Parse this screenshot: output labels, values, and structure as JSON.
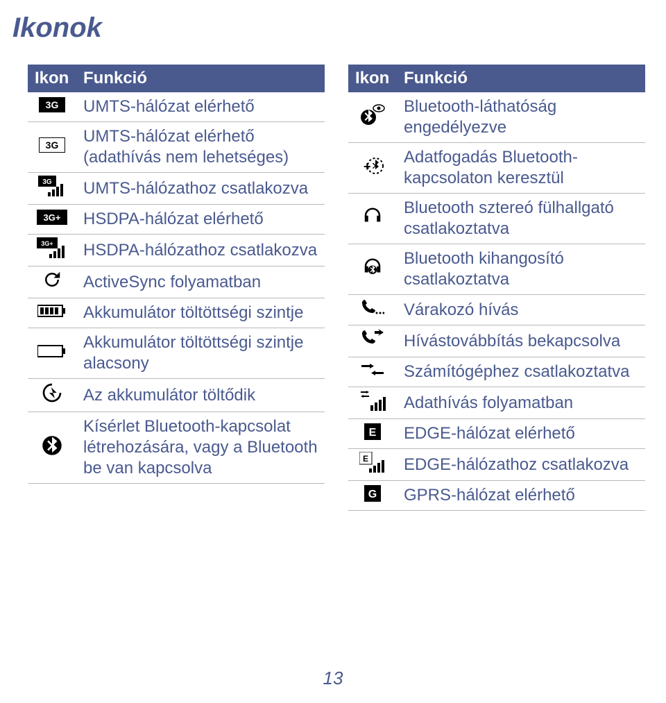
{
  "title": "Ikonok",
  "pageNumber": "13",
  "headers": {
    "icon": "Ikon",
    "func": "Funkció"
  },
  "left": [
    {
      "icon": "3g-box",
      "label": "UMTS-hálózat elérhető"
    },
    {
      "icon": "3g-outline",
      "label": "UMTS-hálózat elérhető (adathívás nem lehetséges)"
    },
    {
      "icon": "3g-signal",
      "label": "UMTS-hálózathoz csatlakozva"
    },
    {
      "icon": "3gplus-box",
      "label": "HSDPA-hálózat elérhető"
    },
    {
      "icon": "3gplus-signal",
      "label": "HSDPA-hálózathoz csatlakozva"
    },
    {
      "icon": "sync-arrows",
      "label": "ActiveSync folyamatban"
    },
    {
      "icon": "battery-full",
      "label": "Akkumulátor töltöttségi szintje"
    },
    {
      "icon": "battery-low",
      "label": "Akkumulátor töltöttségi szintje alacsony"
    },
    {
      "icon": "battery-charge",
      "label": "Az akkumulátor töltődik"
    },
    {
      "icon": "bluetooth",
      "label": "Kísérlet Bluetooth-kapcsolat létrehozására, vagy a Bluetooth be van kapcsolva"
    }
  ],
  "right": [
    {
      "icon": "bluetooth-eye",
      "label": "Bluetooth-láthatóság engedélyezve"
    },
    {
      "icon": "bluetooth-recv",
      "label": "Adatfogadás Bluetooth-kapcsolaton keresztül"
    },
    {
      "icon": "headphones",
      "label": "Bluetooth sztereó fülhallgató csatlakoztatva"
    },
    {
      "icon": "headphones-bt",
      "label": "Bluetooth kihangosító csatlakoztatva"
    },
    {
      "icon": "call-waiting",
      "label": "Várakozó hívás"
    },
    {
      "icon": "call-forward",
      "label": "Hívástovábbítás bekapcsolva"
    },
    {
      "icon": "pc-connect",
      "label": "Számítógéphez csatlakoztatva"
    },
    {
      "icon": "data-signal",
      "label": "Adathívás folyamatban"
    },
    {
      "icon": "e-box",
      "label": "EDGE-hálózat elérhető"
    },
    {
      "icon": "e-signal",
      "label": "EDGE-hálózathoz csatlakozva"
    },
    {
      "icon": "g-box",
      "label": "GPRS-hálózat elérhető"
    }
  ]
}
